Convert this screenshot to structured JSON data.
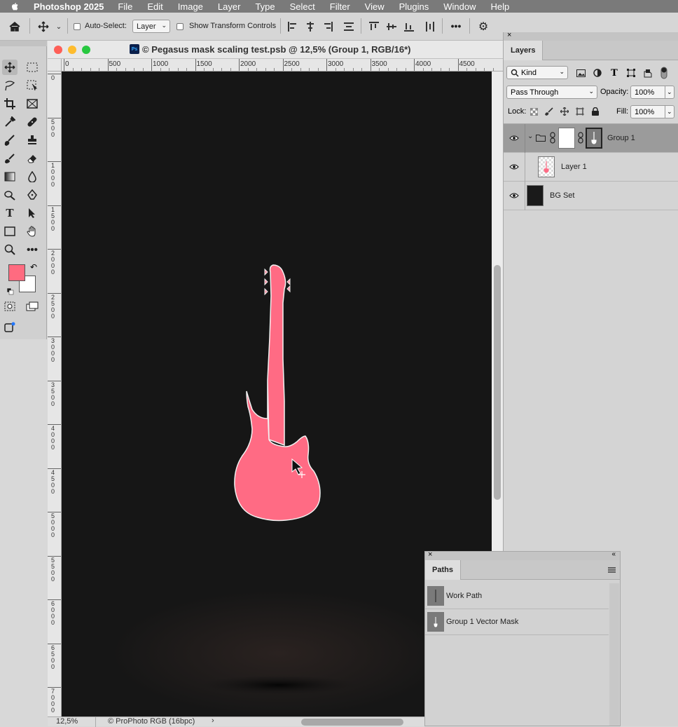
{
  "menubar": {
    "app_name": "Photoshop 2025",
    "items": [
      "File",
      "Edit",
      "Image",
      "Layer",
      "Type",
      "Select",
      "Filter",
      "View",
      "Plugins",
      "Window",
      "Help"
    ]
  },
  "options_bar": {
    "auto_select_label": "Auto-Select:",
    "auto_select_target": "Layer",
    "show_transform_label": "Show Transform Controls",
    "more_label": "•••"
  },
  "document": {
    "title": "© Pegasus mask scaling test.psb @ 12,5% (Group 1, RGB/16*)",
    "ps_badge": "Ps",
    "zoom": "12,5%",
    "color_profile": "© ProPhoto RGB (16bpc)",
    "status_arrow": "›",
    "ruler_h_labels": [
      "0",
      "500",
      "1000",
      "1500",
      "2000",
      "2500",
      "3000",
      "3500",
      "4000",
      "4500"
    ],
    "ruler_v_labels": [
      "0",
      "5\n0\n0",
      "1\n0\n0\n0",
      "1\n5\n0\n0",
      "2\n0\n0\n0",
      "2\n5\n0\n0",
      "3\n0\n0\n0",
      "3\n5\n0\n0",
      "4\n0\n0\n0",
      "4\n5\n0\n0",
      "5\n0\n0\n0",
      "5\n5\n0\n0",
      "6\n0\n0\n0",
      "6\n5\n0\n0",
      "7\n0\n0\n0"
    ]
  },
  "colors": {
    "foreground": "#ff6b80",
    "background": "#ffffff",
    "guitar_fill": "#ff6b84",
    "canvas_bg": "#161616"
  },
  "layers_panel": {
    "tab": "Layers",
    "filter_kind": "Kind",
    "blend_mode": "Pass Through",
    "opacity_label": "Opacity:",
    "opacity_value": "100%",
    "lock_label": "Lock:",
    "fill_label": "Fill:",
    "fill_value": "100%",
    "layers": [
      {
        "name": "Group 1",
        "selected": true
      },
      {
        "name": "Layer 1",
        "selected": false
      },
      {
        "name": "BG Set",
        "selected": false
      }
    ]
  },
  "paths_panel": {
    "tab": "Paths",
    "paths": [
      {
        "name": "Work Path"
      },
      {
        "name": "Group 1 Vector Mask"
      }
    ]
  }
}
